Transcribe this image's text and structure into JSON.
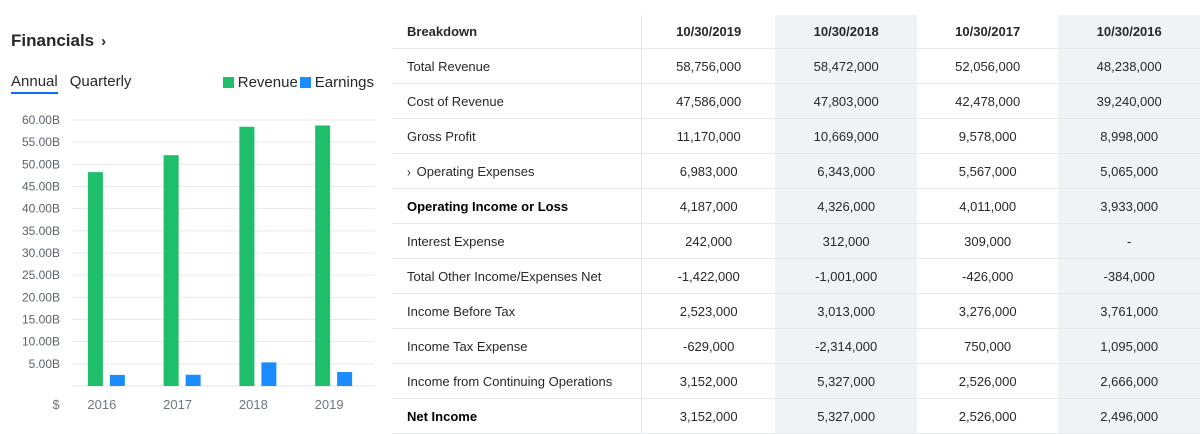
{
  "financials": {
    "title": "Financials",
    "chevron": "›",
    "tabs": [
      "Annual",
      "Quarterly"
    ],
    "active_tab": "Annual",
    "legend": [
      {
        "label": "Revenue",
        "color": "#1ebe6a"
      },
      {
        "label": "Earnings",
        "color": "#1a8cff"
      }
    ]
  },
  "chart_data": {
    "type": "bar",
    "categories": [
      "2016",
      "2017",
      "2018",
      "2019"
    ],
    "series": [
      {
        "name": "Revenue",
        "values": [
          48.24,
          52.06,
          58.47,
          58.76
        ],
        "color": "#1ebe6a"
      },
      {
        "name": "Earnings",
        "values": [
          2.5,
          2.53,
          5.33,
          3.15
        ],
        "color": "#1a8cff"
      }
    ],
    "y_ticks": [
      "5.00B",
      "10.00B",
      "15.00B",
      "20.00B",
      "25.00B",
      "30.00B",
      "35.00B",
      "40.00B",
      "45.00B",
      "50.00B",
      "55.00B",
      "60.00B"
    ],
    "y_axis_unit": "$",
    "ylim": [
      0,
      60
    ],
    "grid": true
  },
  "table": {
    "header": [
      "Breakdown",
      "10/30/2019",
      "10/30/2018",
      "10/30/2017",
      "10/30/2016"
    ],
    "rows": [
      {
        "label": "Total Revenue",
        "bold": false,
        "expand": false,
        "values": [
          "58,756,000",
          "58,472,000",
          "52,056,000",
          "48,238,000"
        ]
      },
      {
        "label": "Cost of Revenue",
        "bold": false,
        "expand": false,
        "values": [
          "47,586,000",
          "47,803,000",
          "42,478,000",
          "39,240,000"
        ]
      },
      {
        "label": "Gross Profit",
        "bold": false,
        "expand": false,
        "values": [
          "11,170,000",
          "10,669,000",
          "9,578,000",
          "8,998,000"
        ]
      },
      {
        "label": "Operating Expenses",
        "bold": false,
        "expand": true,
        "values": [
          "6,983,000",
          "6,343,000",
          "5,567,000",
          "5,065,000"
        ]
      },
      {
        "label": "Operating Income or Loss",
        "bold": true,
        "expand": false,
        "values": [
          "4,187,000",
          "4,326,000",
          "4,011,000",
          "3,933,000"
        ]
      },
      {
        "label": "Interest Expense",
        "bold": false,
        "expand": false,
        "values": [
          "242,000",
          "312,000",
          "309,000",
          "-"
        ]
      },
      {
        "label": "Total Other Income/Expenses Net",
        "bold": false,
        "expand": false,
        "values": [
          "-1,422,000",
          "-1,001,000",
          "-426,000",
          "-384,000"
        ]
      },
      {
        "label": "Income Before Tax",
        "bold": false,
        "expand": false,
        "values": [
          "2,523,000",
          "3,013,000",
          "3,276,000",
          "3,761,000"
        ]
      },
      {
        "label": "Income Tax Expense",
        "bold": false,
        "expand": false,
        "values": [
          "-629,000",
          "-2,314,000",
          "750,000",
          "1,095,000"
        ]
      },
      {
        "label": "Income from Continuing Operations",
        "bold": false,
        "expand": false,
        "values": [
          "3,152,000",
          "5,327,000",
          "2,526,000",
          "2,666,000"
        ]
      },
      {
        "label": "Net Income",
        "bold": true,
        "expand": false,
        "values": [
          "3,152,000",
          "5,327,000",
          "2,526,000",
          "2,496,000"
        ]
      }
    ]
  }
}
